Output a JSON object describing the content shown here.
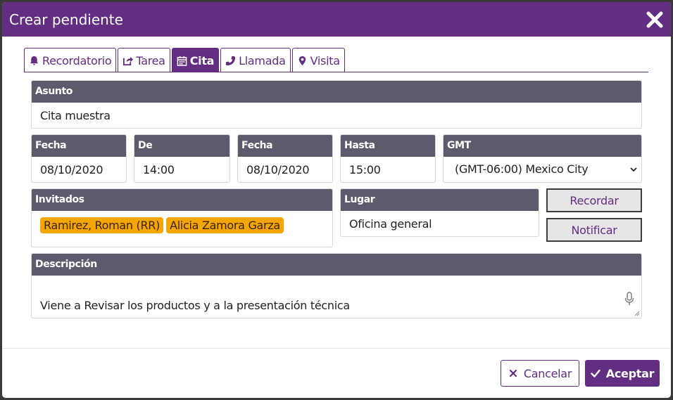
{
  "dialog": {
    "title": "Crear pendiente"
  },
  "tabs": [
    {
      "label": "Recordatorio",
      "icon": "bell-icon"
    },
    {
      "label": "Tarea",
      "icon": "share-icon"
    },
    {
      "label": "Cita",
      "icon": "calendar-icon",
      "active": true
    },
    {
      "label": "Llamada",
      "icon": "phone-icon"
    },
    {
      "label": "Visita",
      "icon": "map-marker-icon"
    }
  ],
  "form": {
    "asunto": {
      "label": "Asunto",
      "value": "Cita muestra"
    },
    "fecha_inicio": {
      "label": "Fecha",
      "value": "08/10/2020"
    },
    "de": {
      "label": "De",
      "value": "14:00"
    },
    "fecha_fin": {
      "label": "Fecha",
      "value": "08/10/2020"
    },
    "hasta": {
      "label": "Hasta",
      "value": "15:00"
    },
    "gmt": {
      "label": "GMT",
      "value": "(GMT-06:00) Mexico City"
    },
    "invitados": {
      "label": "Invitados",
      "chips": [
        "Ramirez, Roman (RR)",
        "Alicia Zamora Garza"
      ]
    },
    "lugar": {
      "label": "Lugar",
      "value": "Oficina general"
    },
    "descripcion": {
      "label": "Descripción",
      "value": "Viene a Revisar los productos y a la presentación técnica"
    }
  },
  "side_buttons": {
    "recordar": "Recordar",
    "notificar": "Notificar"
  },
  "footer": {
    "cancel": "Cancelar",
    "accept": "Aceptar"
  },
  "colors": {
    "brand": "#632d82",
    "label_bg": "#5e5a6e",
    "chip": "#f5a700"
  }
}
